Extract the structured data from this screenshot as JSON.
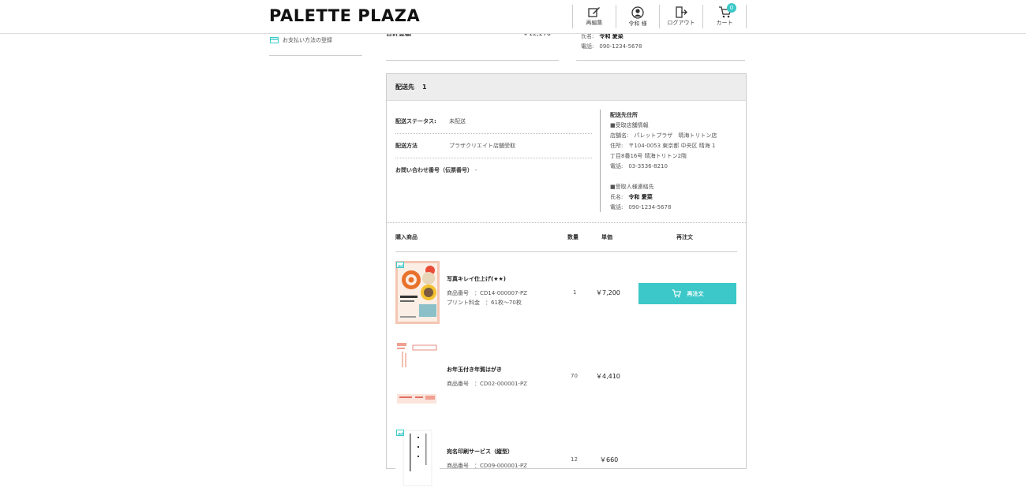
{
  "header": {
    "logo": "PALETTE PLAZA",
    "nav": [
      {
        "label": "再編集",
        "icon": "edit-icon"
      },
      {
        "label": "令和 様",
        "icon": "user-icon"
      },
      {
        "label": "ログアウト",
        "icon": "logout-icon"
      },
      {
        "label": "カート",
        "icon": "cart-icon",
        "badge": "0"
      }
    ]
  },
  "sidebar": {
    "payment_link": "お支払い方法の登録"
  },
  "top_info": {
    "left_label": "合計金額",
    "left_value": "￥12,270",
    "name_label": "氏名:",
    "name_value": "令和 愛菜",
    "phone_label": "電話:",
    "phone_value": "090-1234-5678"
  },
  "delivery": {
    "title": "配送先",
    "number": "1",
    "status_label": "配送ステータス:",
    "status_value": "未配送",
    "method_label": "配送方法",
    "method_value": "プラザクリエイト店舗受取",
    "tracking_label": "お問い合わせ番号（伝票番号）",
    "tracking_value": "-",
    "address_title": "配送先住所",
    "store_header": "■受取店舗情報",
    "store_name": "店舗名:　パレットプラザ　晴海トリトン店",
    "store_addr_line1": "住所:　〒104-0053 東京都 中央区 晴海 1",
    "store_addr_line2": "丁目8番16号 晴海トリトン2階",
    "store_phone": "電話:　03-3536-8210",
    "receiver_header": "■受取人様連絡先",
    "receiver_name_label": "氏名:",
    "receiver_name_value": "令和 愛菜",
    "receiver_phone": "電話:　090-1234-5678"
  },
  "items_header": {
    "product": "購入商品",
    "qty": "数量",
    "unit_price": "単価",
    "reorder": "再注文"
  },
  "items": [
    {
      "name": "写真キレイ仕上げ(★★)",
      "code": "商品番号　：CD14-000007-PZ",
      "detail": "プリント料金　：61枚～70枚",
      "qty": "1",
      "price": "￥7,200",
      "reorder_label": "再注文"
    },
    {
      "name": "お年玉付き年賀はがき",
      "code": "商品番号　：CD02-000001-PZ",
      "qty": "70",
      "price": "￥4,410"
    },
    {
      "name": "宛名印刷サービス（縦型）",
      "code": "商品番号　：CD09-000001-PZ",
      "qty": "12",
      "price": "￥660"
    }
  ],
  "colors": {
    "accent": "#3cc8c8",
    "header_bg": "#ededed"
  }
}
